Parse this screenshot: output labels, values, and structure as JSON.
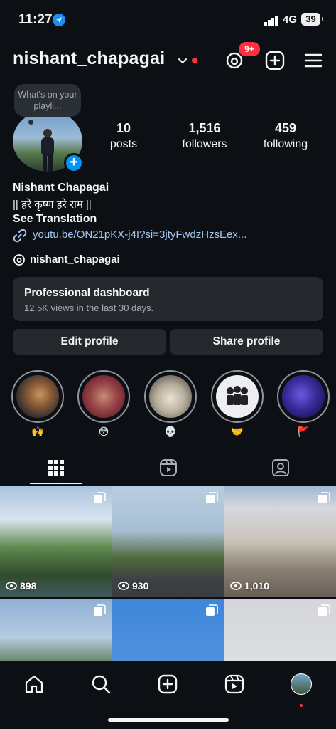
{
  "status_bar": {
    "time": "11:27",
    "network": "4G",
    "battery": "39"
  },
  "header": {
    "username": "nishant_chapagai",
    "notification_badge": "9+"
  },
  "tooltip": "What's on your playli...",
  "stats": {
    "posts": {
      "value": "10",
      "label": "posts"
    },
    "followers": {
      "value": "1,516",
      "label": "followers"
    },
    "following": {
      "value": "459",
      "label": "following"
    }
  },
  "bio": {
    "name": "Nishant Chapagai",
    "line": "|| हरे कृष्ण हरे राम ||",
    "translation": "See Translation",
    "link": "youtu.be/ON21pKX-j4I?si=3jtyFwdzHzsEex...",
    "threads_handle": "nishant_chapagai"
  },
  "dashboard": {
    "title": "Professional dashboard",
    "subtitle": "12.5K views in the last 30 days."
  },
  "buttons": {
    "edit": "Edit profile",
    "share": "Share profile"
  },
  "highlights": [
    {
      "label": "🙌"
    },
    {
      "label": "😳"
    },
    {
      "label": "💀"
    },
    {
      "label": "🤝"
    },
    {
      "label": "🚩"
    }
  ],
  "tabs": [
    "grid-icon",
    "reels-icon",
    "tagged-icon"
  ],
  "posts": [
    {
      "views": "898",
      "multi": true
    },
    {
      "views": "930",
      "multi": true
    },
    {
      "views": "1,010",
      "multi": true
    },
    {
      "views": "",
      "multi": true
    },
    {
      "views": "",
      "multi": true
    },
    {
      "views": "",
      "multi": true
    }
  ],
  "bottom_nav": [
    "home-icon",
    "search-icon",
    "create-icon",
    "reels-icon",
    "profile-avatar"
  ],
  "colors": {
    "background": "#0c1014",
    "accent_blue": "#0095f6",
    "badge_red": "#ff3040",
    "surface": "#25292e",
    "link": "#a3c8f0"
  }
}
